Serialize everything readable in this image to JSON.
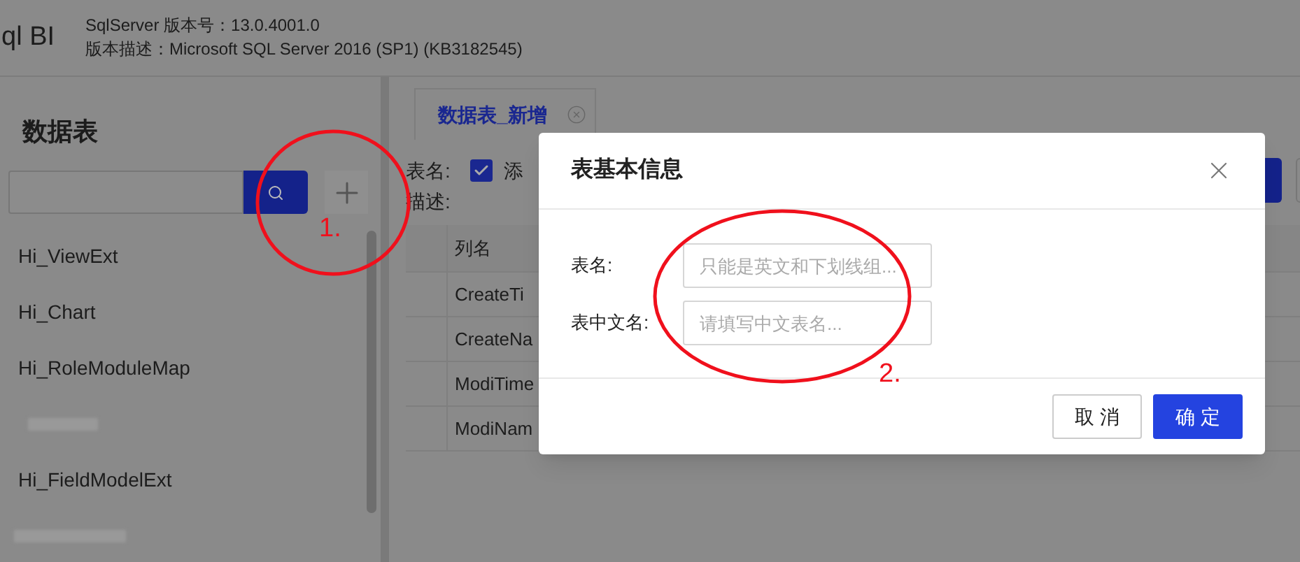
{
  "header": {
    "logo": "ql BI",
    "version": "SqlServer 版本号：13.0.4001.0",
    "description": "版本描述：Microsoft SQL Server 2016 (SP1) (KB3182545)"
  },
  "sidebar": {
    "title": "数据表",
    "items": [
      {
        "kind": "text",
        "label": "Hi_ViewExt"
      },
      {
        "kind": "text",
        "label": "Hi_Chart"
      },
      {
        "kind": "text",
        "label": "Hi_RoleModuleMap"
      },
      {
        "kind": "blurred"
      },
      {
        "kind": "text",
        "label": "Hi_FieldModelExt"
      },
      {
        "kind": "blurred"
      }
    ]
  },
  "tabs": [
    {
      "label": "数据表_新增",
      "selected": true
    }
  ],
  "form": {
    "name_label": "表名:",
    "checkbox": {
      "label": "添",
      "checked": true
    },
    "desc_label": "描述:"
  },
  "table": {
    "columns": [
      "列名"
    ],
    "rows": [
      "CreateTi",
      "CreateNa",
      "ModiTime",
      "ModiNam"
    ]
  },
  "dialog": {
    "title": "表基本信息",
    "fields": [
      {
        "label": "表名:",
        "placeholder": "只能是英文和下划线组..."
      },
      {
        "label": "表中文名:",
        "placeholder": "请填写中文表名..."
      }
    ],
    "buttons": [
      {
        "label": "取 消",
        "kind": "secondary"
      },
      {
        "label": "确 定",
        "kind": "primary"
      }
    ]
  },
  "annotations": [
    {
      "label": "1."
    },
    {
      "label": "2."
    }
  ]
}
